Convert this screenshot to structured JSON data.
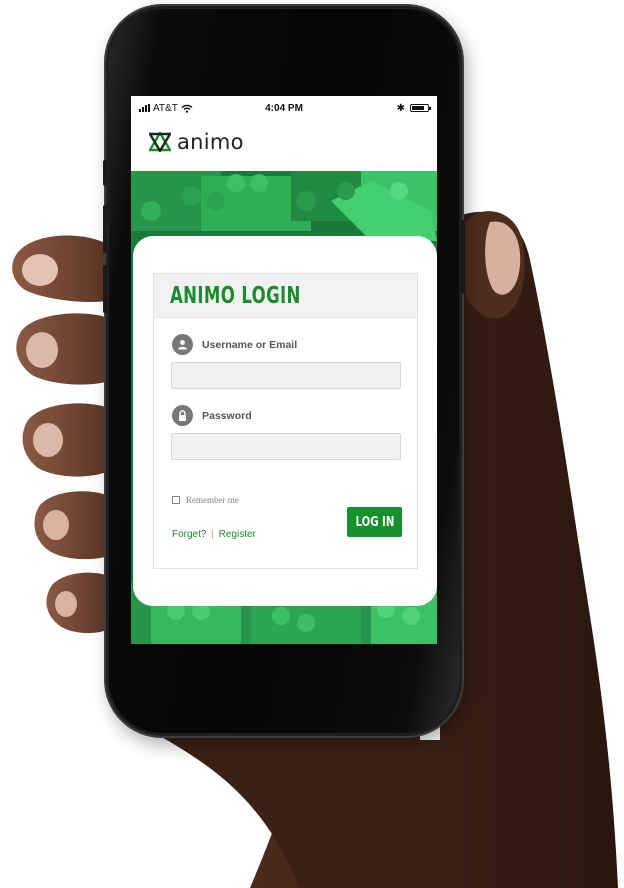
{
  "status_bar": {
    "carrier": "AT&T",
    "time": "4:04 PM",
    "icons": [
      "signal-icon",
      "wifi-icon",
      "bluetooth-icon",
      "battery-icon"
    ],
    "battery_level": 0.8
  },
  "app": {
    "logo_icon": "animo-logo-icon",
    "logo_text": "animo"
  },
  "login": {
    "title": "ANIMO LOGIN",
    "username": {
      "label": "Username or Email",
      "icon": "user-icon",
      "value": ""
    },
    "password": {
      "label": "Password",
      "icon": "lock-icon",
      "value": ""
    },
    "remember_me": {
      "label": "Remember me",
      "checked": false
    },
    "forgot_link": "Forget?",
    "separator": "|",
    "register_link": "Register",
    "submit_label": "LOG IN"
  },
  "colors": {
    "brand_green": "#1a8c2e",
    "button_green": "#15912c",
    "hero_green": "#2fae4f"
  }
}
